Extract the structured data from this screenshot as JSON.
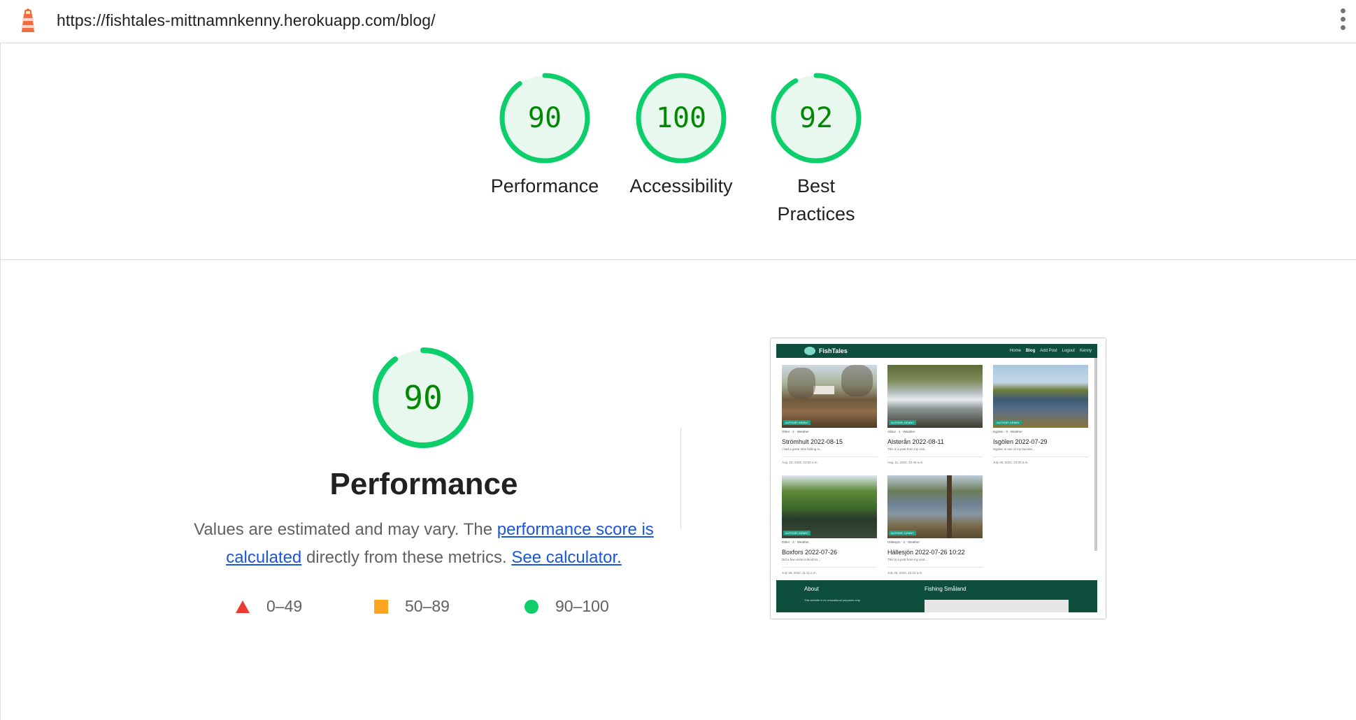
{
  "topbar": {
    "url": "https://fishtales-mittnamnkenny.herokuapp.com/blog/"
  },
  "colors": {
    "pass": "#0cce6b",
    "pass_text": "#008800",
    "pass_bg": "#e9f8ef",
    "average": "#ffa520",
    "fail": "#eb3b30",
    "link": "#1a56db",
    "site_green": "#0d4f3c"
  },
  "scores": [
    {
      "label": "Performance",
      "value": "90",
      "score": 0.9
    },
    {
      "label": "Accessibility",
      "value": "100",
      "score": 1.0
    },
    {
      "label": "Best Practices",
      "value": "92",
      "score": 0.92
    }
  ],
  "performance": {
    "score": "90",
    "score_fraction": 0.9,
    "title": "Performance",
    "desc_prefix": "Values are estimated and may vary. The ",
    "desc_link1": "performance score is calculated",
    "desc_middle": " directly from these metrics. ",
    "desc_link2": "See calculator.",
    "legend": [
      {
        "shape": "triangle",
        "range": "0–49"
      },
      {
        "shape": "square",
        "range": "50–89"
      },
      {
        "shape": "circle",
        "range": "90–100"
      }
    ]
  },
  "thumbnail": {
    "brand": "FishTales",
    "nav": [
      "Home",
      "Blog",
      "Add Post",
      "Logout",
      "Kenny"
    ],
    "active_nav": "Blog",
    "cards": [
      {
        "title": "Strömhult 2022-08-15",
        "badge": "AUTHOR: KENNY",
        "meta": "Other · 2 · Weather",
        "excerpt": "I had a great time fishing in...",
        "date": "Aug. 18, 2022, 10:00 a.m."
      },
      {
        "title": "Alsterån 2022-08-11",
        "badge": "AUTHOR: KENNY",
        "meta": "Abbor · 1 · Weather",
        "excerpt": "This is a post from my visit...",
        "date": "Aug. 11, 2022, 10:45 a.m."
      },
      {
        "title": "Isgölen 2022-07-29",
        "badge": "AUTHOR: KENNY",
        "meta": "Isgölen · 0 · Weather",
        "excerpt": "Isgölen is one of my favorite...",
        "date": "July 29, 2022, 10:00 a.m."
      },
      {
        "title": "Boxfors 2022-07-26",
        "badge": "AUTHOR: KENNY",
        "meta": "Other · 2 · Weather",
        "excerpt": "Did a few visits to Boxfors...",
        "date": "July 26, 2022, 11:11 a.m."
      },
      {
        "title": "Hällesjön 2022-07-26 10:22",
        "badge": "AUTHOR: KENNY",
        "meta": "Hällesjön · 2 · Weather",
        "excerpt": "This is a post from my visit...",
        "date": "July 26, 2022, 10:22 a.m."
      }
    ],
    "footer_about": "About",
    "footer_about_text": "This website is for educational purposes only",
    "footer_map_title": "Fishing Småland"
  }
}
